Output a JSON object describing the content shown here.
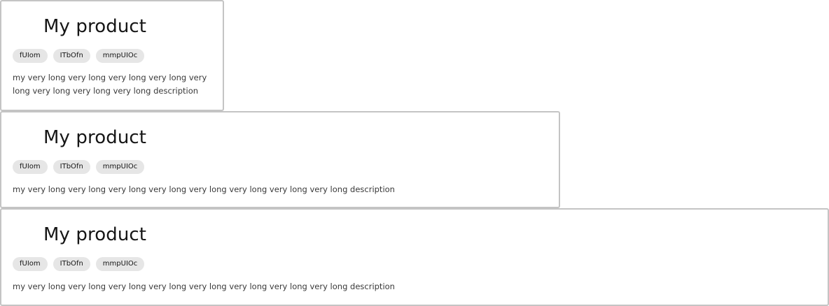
{
  "cards": [
    {
      "title": "My product",
      "tags": [
        "fUIom",
        "ITbOfn",
        "mmpUIOc"
      ],
      "description": "my very long very long very long very long very long very long very long very long description"
    },
    {
      "title": "My product",
      "tags": [
        "fUIom",
        "ITbOfn",
        "mmpUIOc"
      ],
      "description": "my very long very long very long very long very long very long very long very long description"
    },
    {
      "title": "My product",
      "tags": [
        "fUIom",
        "ITbOfn",
        "mmpUIOc"
      ],
      "description": "my very long very long very long very long very long very long very long very long description"
    }
  ]
}
